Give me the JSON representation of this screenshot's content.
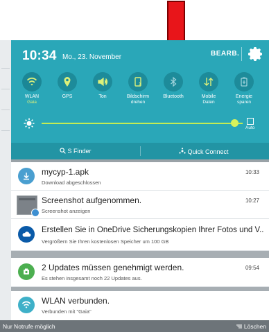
{
  "header": {
    "time": "10:34",
    "date": "Mo., 23. November",
    "edit_label": "BEARB."
  },
  "toggles": [
    {
      "label": "WLAN",
      "sub": "Gaia",
      "icon": "wifi-icon"
    },
    {
      "label": "GPS",
      "sub": "",
      "icon": "location-icon"
    },
    {
      "label": "Ton",
      "sub": "",
      "icon": "sound-icon"
    },
    {
      "label": "Bildschirm",
      "sub": "drehen",
      "icon": "rotate-icon"
    },
    {
      "label": "Bluetooth",
      "sub": "",
      "icon": "bluetooth-icon"
    },
    {
      "label": "Mobile",
      "sub": "Daten",
      "icon": "mobile-data-icon"
    },
    {
      "label": "Energie",
      "sub": "sparen",
      "icon": "power-saving-icon"
    }
  ],
  "brightness": {
    "level": 0.96,
    "auto_label": "Auto"
  },
  "finder": {
    "s_finder": "S Finder",
    "quick_connect": "Quick Connect"
  },
  "notifications": [
    {
      "title": "mycyp-1.apk",
      "sub": "Download abgeschlossen",
      "time": "10:33",
      "icon": "download-icon"
    },
    {
      "title": "Screenshot aufgenommen.",
      "sub": "Screenshot anzeigen",
      "time": "10:27",
      "icon": "screenshot-thumbnail-icon"
    },
    {
      "title": "Erstellen Sie in OneDrive Sicherungskopien Ihrer Fotos und V..",
      "sub": "Vergrößern Sie Ihren kostenlosen Speicher um 100 GB",
      "time": "",
      "icon": "onedrive-icon"
    },
    {
      "title": "2 Updates müssen genehmigt werden.",
      "sub": "Es stehen insgesamt noch 22 Updates aus.",
      "time": "09:54",
      "icon": "update-icon"
    },
    {
      "title": "WLAN verbunden.",
      "sub": "Verbunden mit \"Gaia\"",
      "time": "",
      "icon": "wifi-icon"
    }
  ],
  "statusbar": {
    "left": "Nur Notrufe möglich",
    "right": "Löschen"
  },
  "colors": {
    "panel": "#2aa7b8",
    "accent_slider": "#c2ec53",
    "arrow": "#e8151a"
  }
}
